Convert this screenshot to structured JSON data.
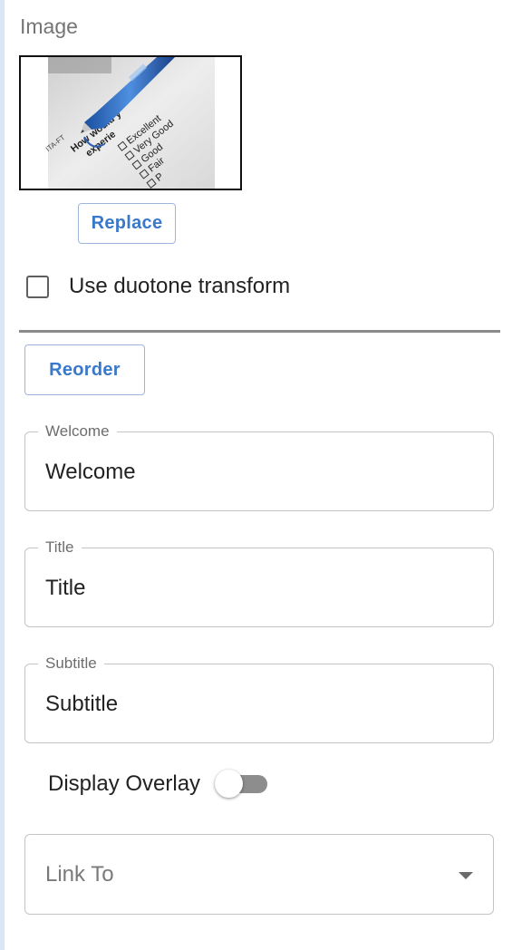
{
  "image_section": {
    "label": "Image",
    "thumbnail": {
      "question_text": "How would y",
      "question_text_2": "experie",
      "header_text": "ITA-FT",
      "options": [
        "Excellent",
        "Very Good",
        "Good",
        "Fair",
        "P"
      ]
    },
    "replace_label": "Replace",
    "duotone_label": "Use duotone transform",
    "duotone_checked": false
  },
  "reorder_label": "Reorder",
  "fields": [
    {
      "legend": "Welcome",
      "value": "Welcome"
    },
    {
      "legend": "Title",
      "value": "Title"
    },
    {
      "legend": "Subtitle",
      "value": "Subtitle"
    }
  ],
  "overlay": {
    "label": "Display Overlay",
    "enabled": false
  },
  "link_to": {
    "placeholder": "Link To"
  },
  "colors": {
    "accent": "#3a78c9",
    "divider": "#8a8a8a",
    "toggle_track_off": "#8d8d8d"
  }
}
